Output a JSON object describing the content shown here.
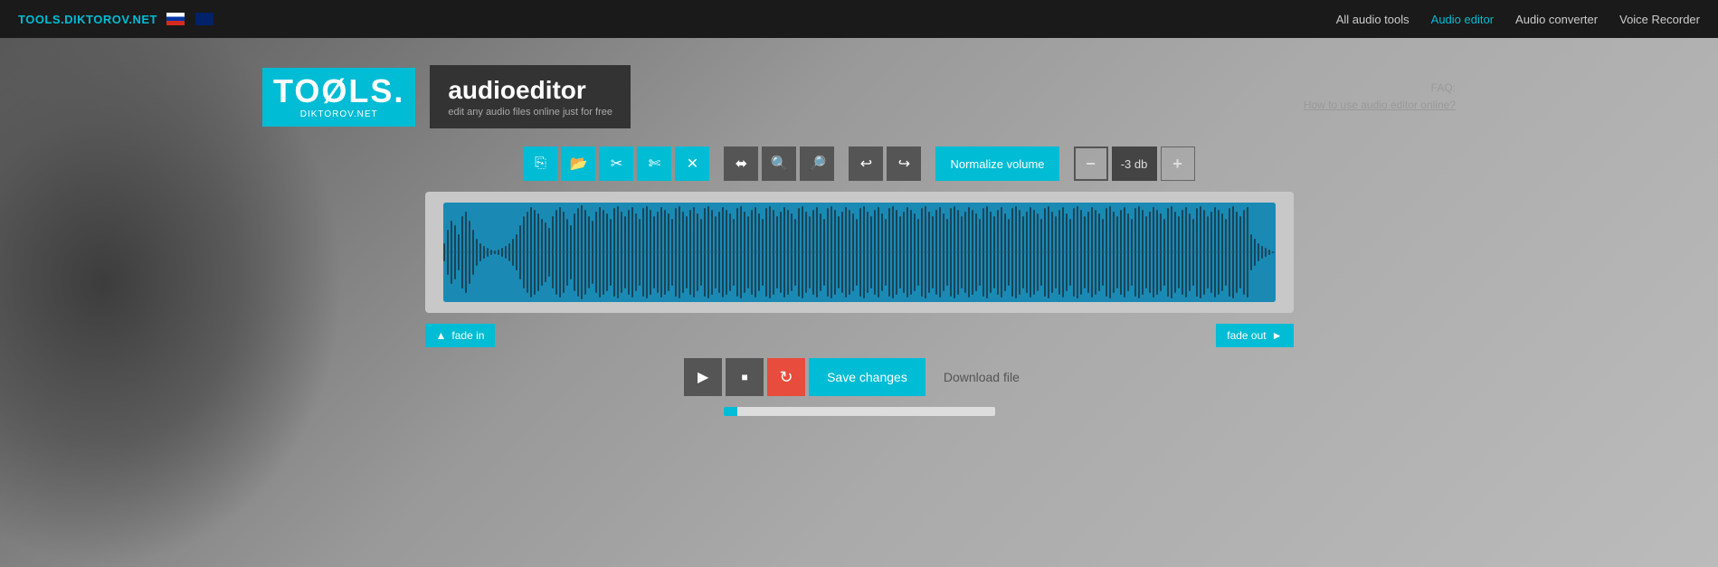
{
  "site": {
    "name": "TOOLS.DIKTOROV.NET",
    "url_label": "TOOLS.DIKTOROV.NET"
  },
  "nav": {
    "links": [
      {
        "label": "All audio tools",
        "active": false
      },
      {
        "label": "Audio editor",
        "active": true
      },
      {
        "label": "Audio converter",
        "active": false
      },
      {
        "label": "Voice Recorder",
        "active": false
      }
    ]
  },
  "logo": {
    "tools_text": "TOØLS.",
    "domain_text": "DIKTOROV.NET"
  },
  "banner": {
    "prefix": "audio",
    "bold": "editor",
    "subtitle": "edit any audio files online just for free"
  },
  "faq": {
    "label": "FAQ:",
    "link": "How to use audio editor online?"
  },
  "toolbar": {
    "buttons": [
      {
        "icon": "⧉",
        "name": "copy-btn",
        "title": "Copy"
      },
      {
        "icon": "📂",
        "name": "open-btn",
        "title": "Open"
      },
      {
        "icon": "✂",
        "name": "cut-btn",
        "title": "Cut"
      },
      {
        "icon": "✄",
        "name": "trim-btn",
        "title": "Trim"
      },
      {
        "icon": "✕",
        "name": "delete-btn",
        "title": "Delete"
      }
    ],
    "zoom_buttons": [
      {
        "icon": "⬌",
        "name": "fit-btn",
        "title": "Fit"
      },
      {
        "icon": "🔍+",
        "name": "zoom-in-btn",
        "title": "Zoom In"
      },
      {
        "icon": "🔍-",
        "name": "zoom-out-btn",
        "title": "Zoom Out"
      }
    ],
    "undo_redo": [
      {
        "icon": "↩",
        "name": "undo-btn",
        "title": "Undo"
      },
      {
        "icon": "↪",
        "name": "redo-btn",
        "title": "Redo"
      }
    ],
    "normalize_label": "Normalize volume",
    "volume_minus_label": "−",
    "volume_db_label": "-3 db",
    "volume_plus_label": "+"
  },
  "fade": {
    "fade_in_label": "fade in",
    "fade_out_label": "fade out"
  },
  "playback": {
    "play_label": "▶",
    "stop_label": "■",
    "reload_label": "↻",
    "save_label": "Save changes",
    "download_label": "Download file"
  },
  "progress": {
    "percent": 5
  },
  "colors": {
    "cyan": "#00bcd4",
    "dark": "#1a1a1a",
    "toolbar_bg": "#555",
    "red": "#e74c3c"
  }
}
